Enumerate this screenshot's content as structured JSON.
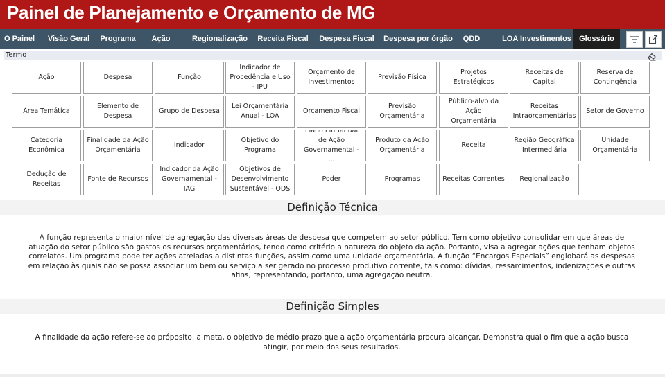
{
  "app": {
    "title": "Painel de Planejamento e Orçamento de MG"
  },
  "nav": {
    "items": [
      {
        "label": "O Painel"
      },
      {
        "label": "Visão Geral"
      },
      {
        "label": "Programa"
      },
      {
        "label": "Ação"
      },
      {
        "label": "Regionalização"
      },
      {
        "label": "Receita Fiscal"
      },
      {
        "label": "Despesa Fiscal"
      },
      {
        "label": "Despesa por órgão"
      },
      {
        "label": "QDD"
      },
      {
        "label": "LOA Investimentos"
      },
      {
        "label": "Glossário"
      }
    ],
    "active": "Glossário",
    "icons": [
      "filter-icon",
      "expand-icon"
    ]
  },
  "slicer": {
    "label": "Termo",
    "clear_icon": "eraser-icon"
  },
  "terms": [
    "Ação",
    "Despesa",
    "Função",
    "Indicador de Procedência e Uso - IPU",
    "Orçamento de Investimentos",
    "Previsão Física",
    "Projetos Estratégicos",
    "Receitas de Capital",
    "Reserva de Contingência",
    "Área Temática",
    "Elemento de Despesa",
    "Grupo de Despesa",
    "Lei Orçamentária Anual - LOA",
    "Orçamento Fiscal",
    "Previsão Orçamentária",
    "Público-alvo da Ação Orçamentária",
    "Receitas Intraorçamentárias",
    "Setor de Governo",
    "Categoria Econômica",
    "Finalidade da Ação Orçamentária",
    "Indicador",
    "Objetivo do Programa",
    "Plano Plurianual de Ação Governamental - ...",
    "Produto da Ação Orçamentária",
    "Receita",
    "Região Geográfica Intermediária",
    "Unidade Orçamentária",
    "Dedução de Receitas",
    "Fonte de Recursos",
    "Indicador da Ação Governamental - IAG",
    "Objetivos de Desenvolvimento Sustentável - ODS",
    "Poder",
    "Programas",
    "Receitas Correntes",
    "Regionalização"
  ],
  "definicao_tecnica": {
    "title": "Definição Técnica",
    "text": "A função representa o maior nível de agregação das diversas áreas de despesa que competem ao setor público. Tem como objetivo consolidar em que áreas de atuação do setor público são gastos os recursos orçamentários, tendo como critério a natureza do objeto da ação. Portanto, visa a agregar ações que tenham objetos correlatos. Um programa pode ter ações atreladas a distintas funções, assim como uma unidade orçamentária. A função “Encargos Especiais” englobará as despesas em relação às quais não se possa associar um bem ou serviço a ser gerado no processo produtivo corrente, tais como: dívidas, ressarcimentos, indenizações e outras afins, representando, portanto, uma agregação neutra."
  },
  "definicao_simples": {
    "title": "Definição Simples",
    "text": "A finalidade da ação refere-se ao próposito, a meta, o objetivo de médio prazo que a ação orçamentária procura alcançar. Demonstra qual o fim que a ação busca atingir, por meio dos seus resultados."
  },
  "colors": {
    "header_bg": "#b01818",
    "nav_bg": "#3d5566",
    "nav_active_bg": "#1f1f1f",
    "tile_border": "#9e9e9e"
  }
}
